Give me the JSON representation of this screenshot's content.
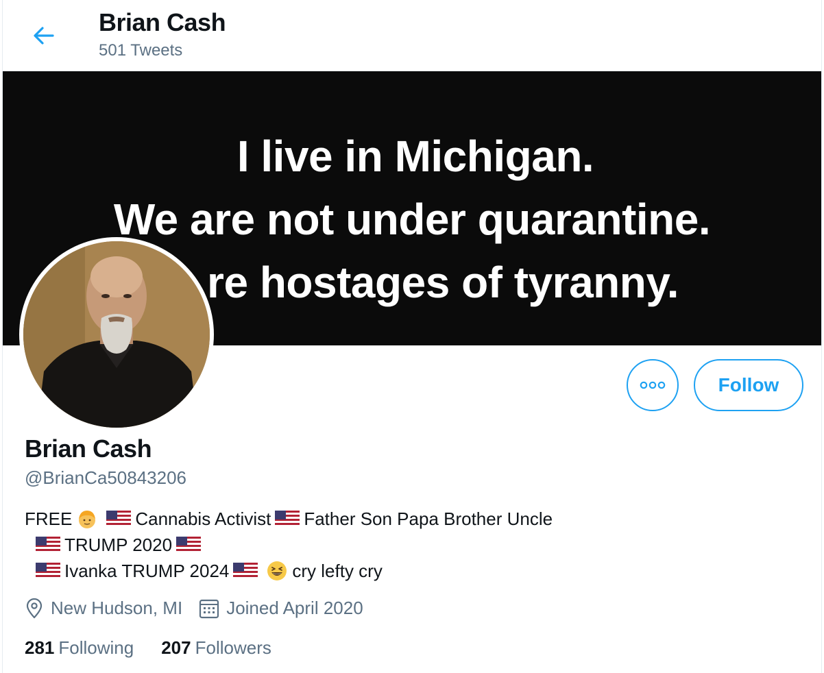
{
  "header": {
    "title": "Brian Cash",
    "tweet_count": "501 Tweets"
  },
  "banner": {
    "line1": "I live in Michigan.",
    "line2": "We are not under quarantine.",
    "line3": "re hostages of tyranny."
  },
  "actions": {
    "follow_label": "Follow"
  },
  "profile": {
    "name": "Brian Cash",
    "handle": "@BrianCa50843206",
    "bio": {
      "free": "FREE",
      "cannabis": "Cannabis Activist",
      "father": "Father Son Papa Brother Uncle",
      "trump": "TRUMP 2020",
      "ivanka": "Ivanka TRUMP 2024",
      "cry": "cry lefty cry"
    },
    "location": "New Hudson, MI",
    "joined": "Joined April 2020",
    "following_count": "281",
    "following_label": "Following",
    "followers_count": "207",
    "followers_label": "Followers"
  },
  "colors": {
    "accent": "#1da1f2",
    "muted": "#5b7083",
    "text": "#0f1419"
  }
}
